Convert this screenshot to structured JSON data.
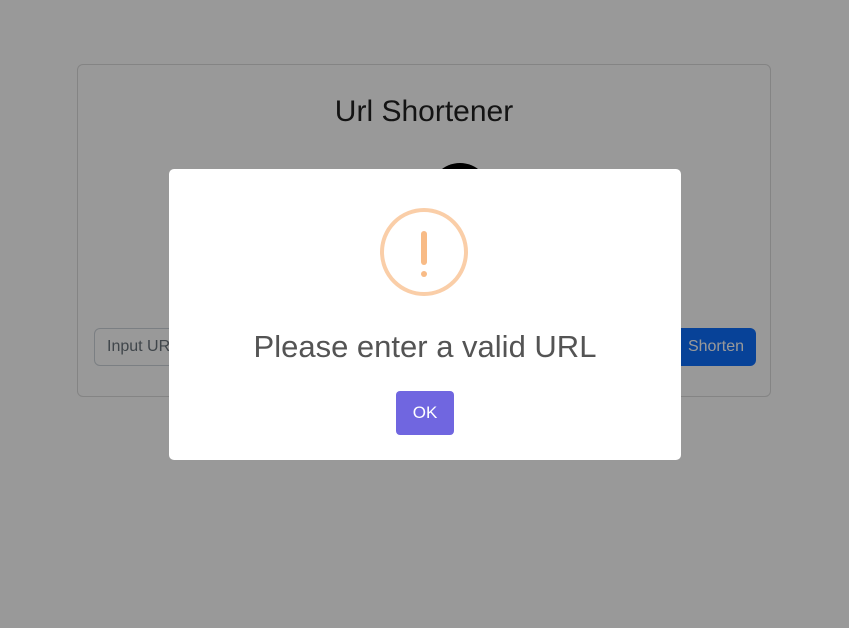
{
  "card": {
    "title": "Url Shortener",
    "input_placeholder": "Input URL",
    "input_value": "",
    "shorten_label": "Shorten"
  },
  "modal": {
    "icon": "warning-icon",
    "icon_color": "#f8bb86",
    "title": "Please enter a valid URL",
    "confirm_label": "OK",
    "confirm_color": "#7066e0"
  },
  "colors": {
    "primary": "#0d6efd",
    "backdrop": "rgba(0,0,0,0.4)"
  }
}
